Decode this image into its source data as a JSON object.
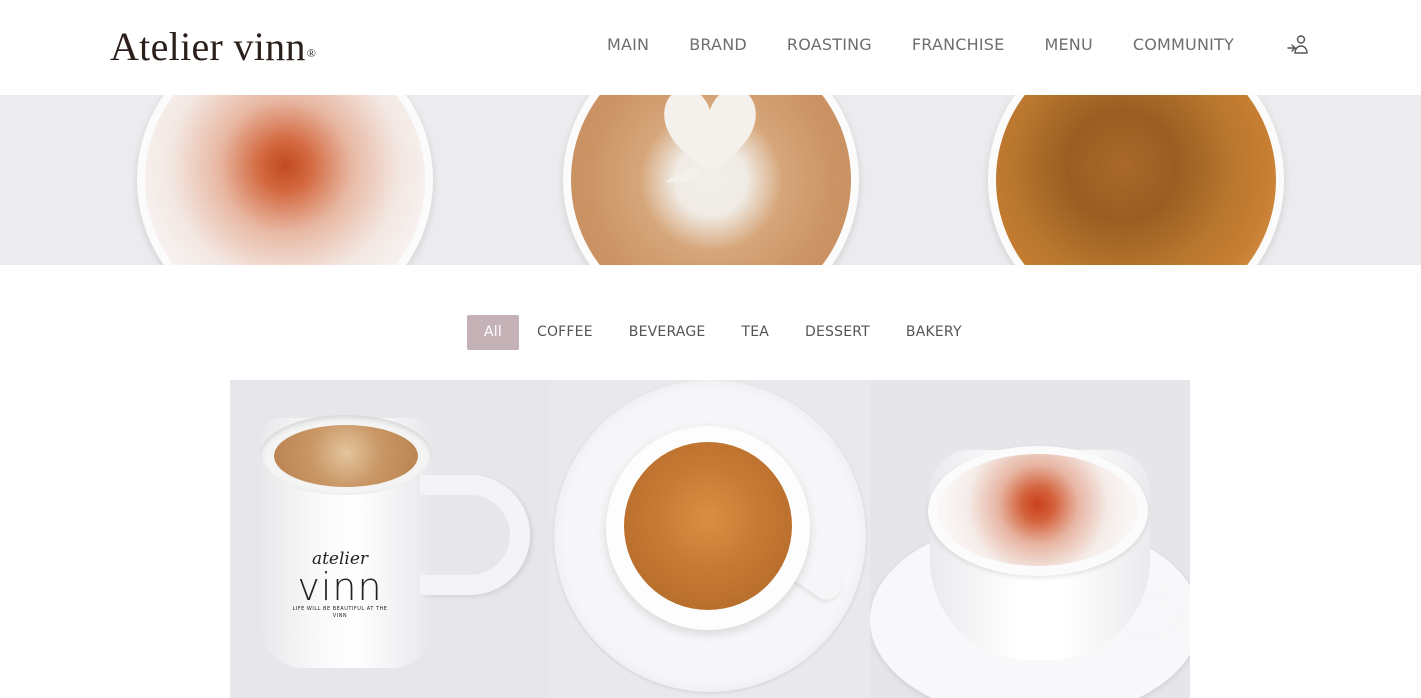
{
  "header": {
    "logo_text": "Atelier vinn",
    "logo_mark": "®",
    "nav": [
      "MAIN",
      "BRAND",
      "ROASTING",
      "FRANCHISE",
      "MENU",
      "COMMUNITY"
    ],
    "login_icon": "login-user-icon"
  },
  "hero": {
    "images": [
      "cappuccino-top-view",
      "latte-art-heart",
      "espresso-top-view"
    ]
  },
  "filters": {
    "tabs": [
      "All",
      "COFFEE",
      "BEVERAGE",
      "TEA",
      "DESSERT",
      "BAKERY"
    ],
    "active": "All",
    "active_color": "#c4b2b6"
  },
  "products": {
    "items": [
      {
        "image": "americano-mug",
        "mug_print_top": "atelier",
        "mug_print_main": "vinn",
        "mug_print_tagline": "LIFE WILL BE BEAUTIFUL AT THE VINN"
      },
      {
        "image": "espresso-cup-top-view"
      },
      {
        "image": "cappuccino-cup"
      }
    ]
  }
}
